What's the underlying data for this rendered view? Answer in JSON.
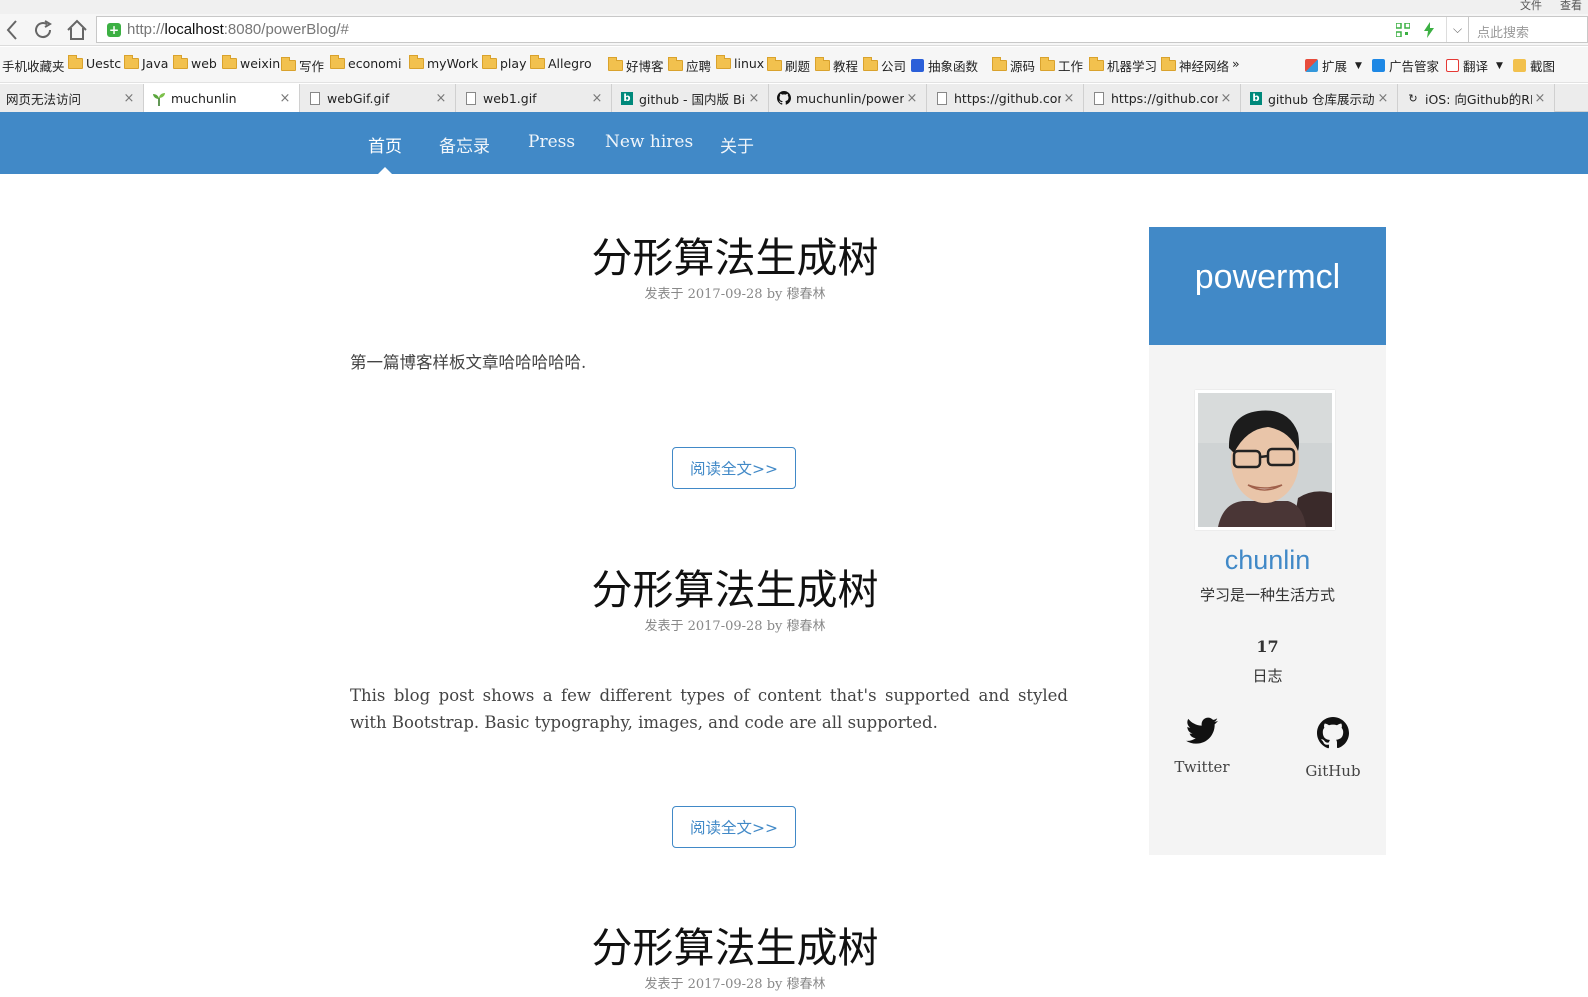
{
  "browser": {
    "menus": [
      "文件",
      "查看"
    ],
    "url_prefix": "http://",
    "url_host": "localhost",
    "url_rest": ":8080/powerBlog/#",
    "search_placeholder": "点此搜索",
    "bookmarks": [
      {
        "label": "手机收藏夹",
        "icon": "none"
      },
      {
        "label": "Uestc",
        "icon": "folder"
      },
      {
        "label": "Java",
        "icon": "folder"
      },
      {
        "label": "web",
        "icon": "folder"
      },
      {
        "label": "weixin",
        "icon": "folder"
      },
      {
        "label": "写作",
        "icon": "folder"
      },
      {
        "label": "economi",
        "icon": "folder"
      },
      {
        "label": "myWork",
        "icon": "folder"
      },
      {
        "label": "play",
        "icon": "folder"
      },
      {
        "label": "Allegro",
        "icon": "folder"
      },
      {
        "label": "好博客",
        "icon": "folder"
      },
      {
        "label": "应聘",
        "icon": "folder"
      },
      {
        "label": "linux",
        "icon": "folder"
      },
      {
        "label": "刷题",
        "icon": "folder"
      },
      {
        "label": "教程",
        "icon": "folder"
      },
      {
        "label": "公司",
        "icon": "folder"
      },
      {
        "label": "抽象函数",
        "icon": "baidu"
      },
      {
        "label": "源码",
        "icon": "folder"
      },
      {
        "label": "工作",
        "icon": "folder"
      },
      {
        "label": "机器学习",
        "icon": "folder"
      },
      {
        "label": "神经网络",
        "icon": "folder"
      }
    ],
    "bookmarks_more": "»",
    "toolbar": [
      "扩展",
      "广告管家",
      "翻译",
      "截图"
    ],
    "tabs": [
      {
        "label": "网页无法访问",
        "icon": "none",
        "active": false
      },
      {
        "label": "muchunlin",
        "icon": "sprout",
        "active": true
      },
      {
        "label": "webGif.gif",
        "icon": "page",
        "active": false
      },
      {
        "label": "web1.gif",
        "icon": "page",
        "active": false
      },
      {
        "label": "github - 国内版 Bi",
        "icon": "bing",
        "active": false
      },
      {
        "label": "muchunlin/powerl",
        "icon": "github",
        "active": false
      },
      {
        "label": "https://github.con",
        "icon": "page",
        "active": false
      },
      {
        "label": "https://github.con",
        "icon": "page",
        "active": false
      },
      {
        "label": "github 仓库展示动",
        "icon": "bing",
        "active": false
      },
      {
        "label": "iOS: 向Github的RE",
        "icon": "refresh",
        "active": false
      }
    ]
  },
  "nav": {
    "items": [
      "首页",
      "备忘录",
      "Press",
      "New hires",
      "关于"
    ],
    "active_index": 0,
    "color": "#4189c7"
  },
  "posts": [
    {
      "title": "分形算法生成树",
      "meta": "发表于 2017-09-28 by 穆春林",
      "excerpt": "第一篇博客样板文章哈哈哈哈哈.",
      "read_more": "阅读全文>>"
    },
    {
      "title": "分形算法生成树",
      "meta": "发表于 2017-09-28 by 穆春林",
      "excerpt": "This blog post shows a few different types of content that's supported and styled with Bootstrap. Basic typography, images, and code are all supported.",
      "read_more": "阅读全文>>"
    },
    {
      "title": "分形算法生成树",
      "meta": "发表于 2017-09-28 by 穆春林"
    }
  ],
  "sidebar": {
    "site_name": "powermcl",
    "author_name": "chunlin",
    "motto": "学习是一种生活方式",
    "post_count": "17",
    "post_count_label": "日志",
    "social": [
      {
        "label": "Twitter",
        "icon": "twitter-icon"
      },
      {
        "label": "GitHub",
        "icon": "github-icon"
      }
    ]
  }
}
